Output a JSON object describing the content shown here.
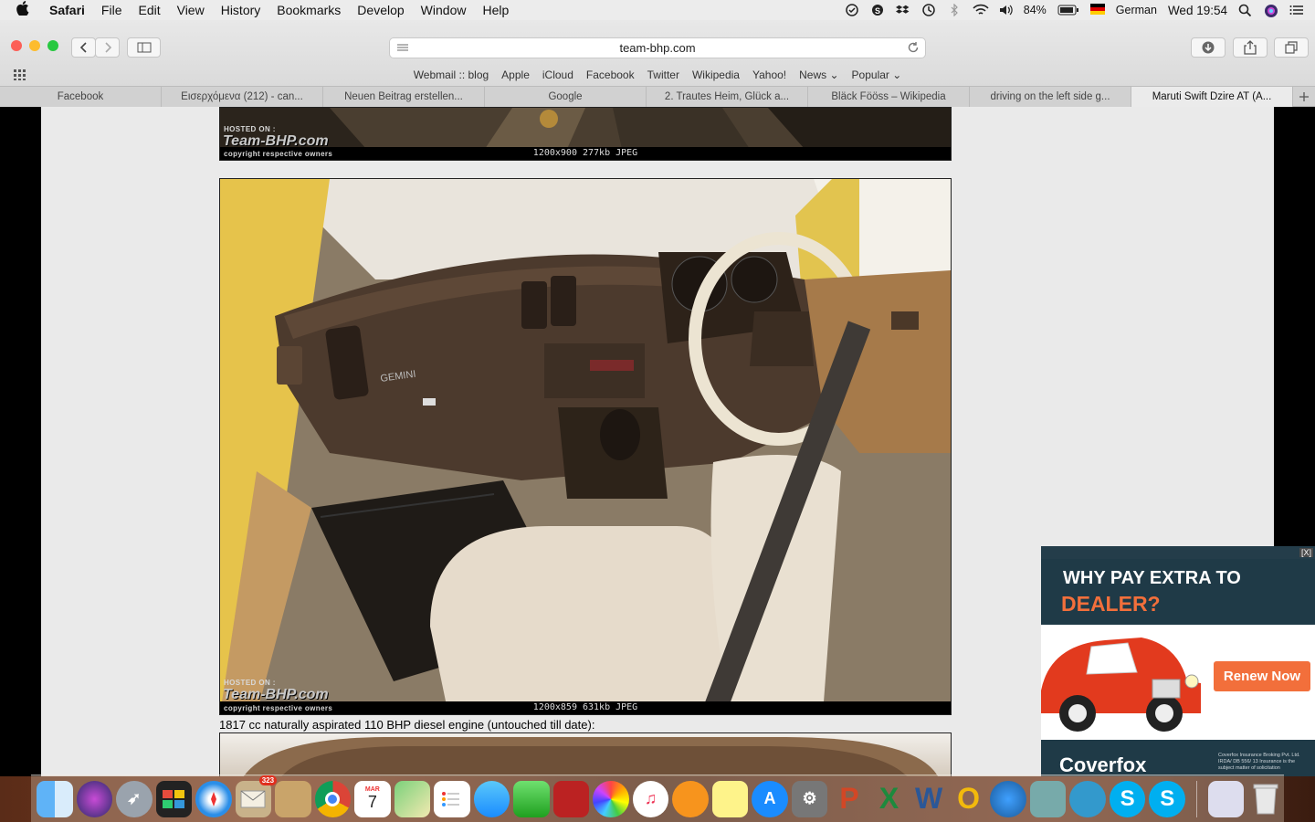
{
  "menubar": {
    "apple": "",
    "app": "Safari",
    "items": [
      "File",
      "Edit",
      "View",
      "History",
      "Bookmarks",
      "Develop",
      "Window",
      "Help"
    ],
    "battery": "84%",
    "input_source": "German",
    "clock": "Wed 19:54"
  },
  "toolbar": {
    "url": "team-bhp.com"
  },
  "bookmarks": [
    "Webmail :: blog",
    "Apple",
    "iCloud",
    "Facebook",
    "Twitter",
    "Wikipedia",
    "Yahoo!",
    "News ⌄",
    "Popular ⌄"
  ],
  "tabs": [
    {
      "label": "Facebook"
    },
    {
      "label": "Εισερχόμενα (212) - can..."
    },
    {
      "label": "Neuen Beitrag erstellen..."
    },
    {
      "label": "Google"
    },
    {
      "label": "2. Trautes Heim, Glück a..."
    },
    {
      "label": "Bläck Fööss – Wikipedia"
    },
    {
      "label": "driving on the left side g..."
    },
    {
      "label": "Maruti Swift Dzire AT (A..."
    }
  ],
  "content": {
    "img1_caption": "1200x900  277kb  JPEG",
    "img2_caption": "1200x859  631kb  JPEG",
    "watermark_brand": "Team-BHP.com",
    "watermark_hosted": "HOSTED ON :",
    "watermark_copy": "copyright respective owners",
    "dash_badge": "GEMINI",
    "text": "1817 cc naturally aspirated 110 BHP diesel engine (untouched till date):"
  },
  "ad": {
    "close": "[X]",
    "headline1": "WHY PAY EXTRA TO",
    "headline2": "DEALER?",
    "cta": "Renew Now",
    "brand": "Coverfox",
    "fineprint": "Coverfox Insurance Broking Pvt. Ltd. IRDA/ DB 556/ 13 Insurance is the subject matter of solicitation",
    "accent": "#f26f3b"
  },
  "dock": {
    "mail_badge": "323",
    "calendar_month": "MAR",
    "calendar_day": "7"
  }
}
